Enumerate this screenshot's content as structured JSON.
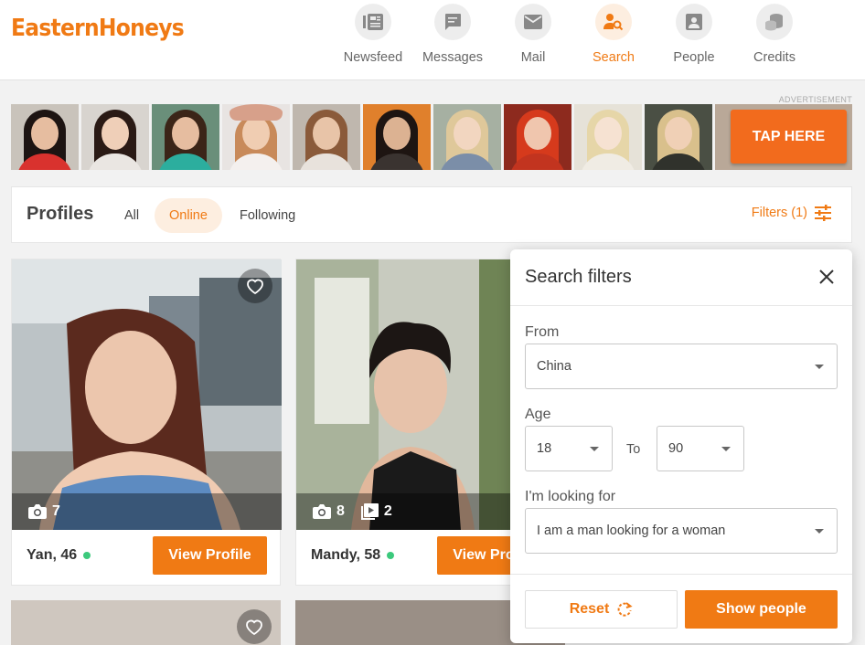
{
  "brand": {
    "logo": "EasternHoneys",
    "accent": "#f07a14"
  },
  "nav": [
    {
      "label": "Newsfeed",
      "icon": "newsfeed-icon",
      "active": false
    },
    {
      "label": "Messages",
      "icon": "messages-icon",
      "active": false
    },
    {
      "label": "Mail",
      "icon": "mail-icon",
      "active": false
    },
    {
      "label": "Search",
      "icon": "search-people-icon",
      "active": true
    },
    {
      "label": "People",
      "icon": "people-icon",
      "active": false
    },
    {
      "label": "Credits",
      "icon": "credits-icon",
      "active": false
    }
  ],
  "ad": {
    "label": "ADVERTISEMENT",
    "cta": "TAP HERE"
  },
  "profiles": {
    "title": "Profiles",
    "tabs": [
      "All",
      "Online",
      "Following"
    ],
    "active_tab": "Online",
    "filters_label": "Filters (1)"
  },
  "cards": [
    {
      "name": "Yan, 46",
      "online": true,
      "photos": "7",
      "videos": null,
      "button": "View Profile"
    },
    {
      "name": "Mandy, 58",
      "online": true,
      "photos": "8",
      "videos": "2",
      "button": "View Profile"
    }
  ],
  "filters": {
    "title": "Search filters",
    "from_label": "From",
    "from_value": "China",
    "age_label": "Age",
    "age_from": "18",
    "age_to_label": "To",
    "age_to": "90",
    "looking_label": "I'm looking for",
    "looking_value": "I am a man looking for a woman",
    "reset_label": "Reset",
    "show_label": "Show people"
  }
}
